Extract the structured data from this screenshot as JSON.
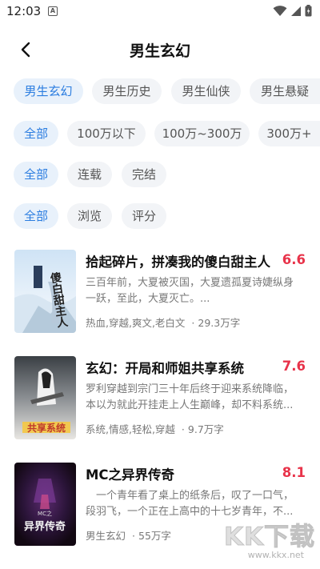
{
  "status": {
    "time": "12:03",
    "notif_letter": "A"
  },
  "header": {
    "title": "男生玄幻"
  },
  "filters": {
    "categories": [
      "男生玄幻",
      "男生历史",
      "男生仙侠",
      "男生悬疑"
    ],
    "word_counts": [
      "全部",
      "100万以下",
      "100万~300万",
      "300万+"
    ],
    "status": [
      "全部",
      "连载",
      "完结"
    ],
    "sort": [
      "全部",
      "浏览",
      "评分"
    ]
  },
  "books": [
    {
      "title": "拾起碎片，拼凑我的傻白甜主人",
      "score": "6.6",
      "desc": "三百年前，大夏被灭国，大夏遗孤夏诗婕纵身一跃，至此，大夏灭亡。...",
      "tags": "热血,穿越,爽文,老白文",
      "words": "29.3万字",
      "cover_text": "傻白甜主人"
    },
    {
      "title": "玄幻：开局和师姐共享系统",
      "score": "7.6",
      "desc": "罗利穿越到宗门三十年后终于迎来系统降临，本以为就此开挂走上人生巅峰，却不料系统...",
      "tags": "系统,情感,轻松,穿越",
      "words": "9.7万字",
      "cover_text": "共享系统"
    },
    {
      "title": "MC之异界传奇",
      "score": "8.1",
      "desc": "　一个青年看了桌上的纸条后，叹了一口气，段羽飞，一个正在上高中的十七岁青年，不...",
      "tags": "男生玄幻",
      "words": "55万字",
      "cover_text": "异界传奇",
      "cover_sub": "MC之"
    }
  ],
  "watermark": {
    "main": "KK下载",
    "url": "www.kkx.net"
  },
  "colors": {
    "accent": "#2b7de0",
    "score": "#e8334a",
    "chip_bg": "#f2f4f7",
    "chip_active_bg": "#e8f1fb"
  }
}
